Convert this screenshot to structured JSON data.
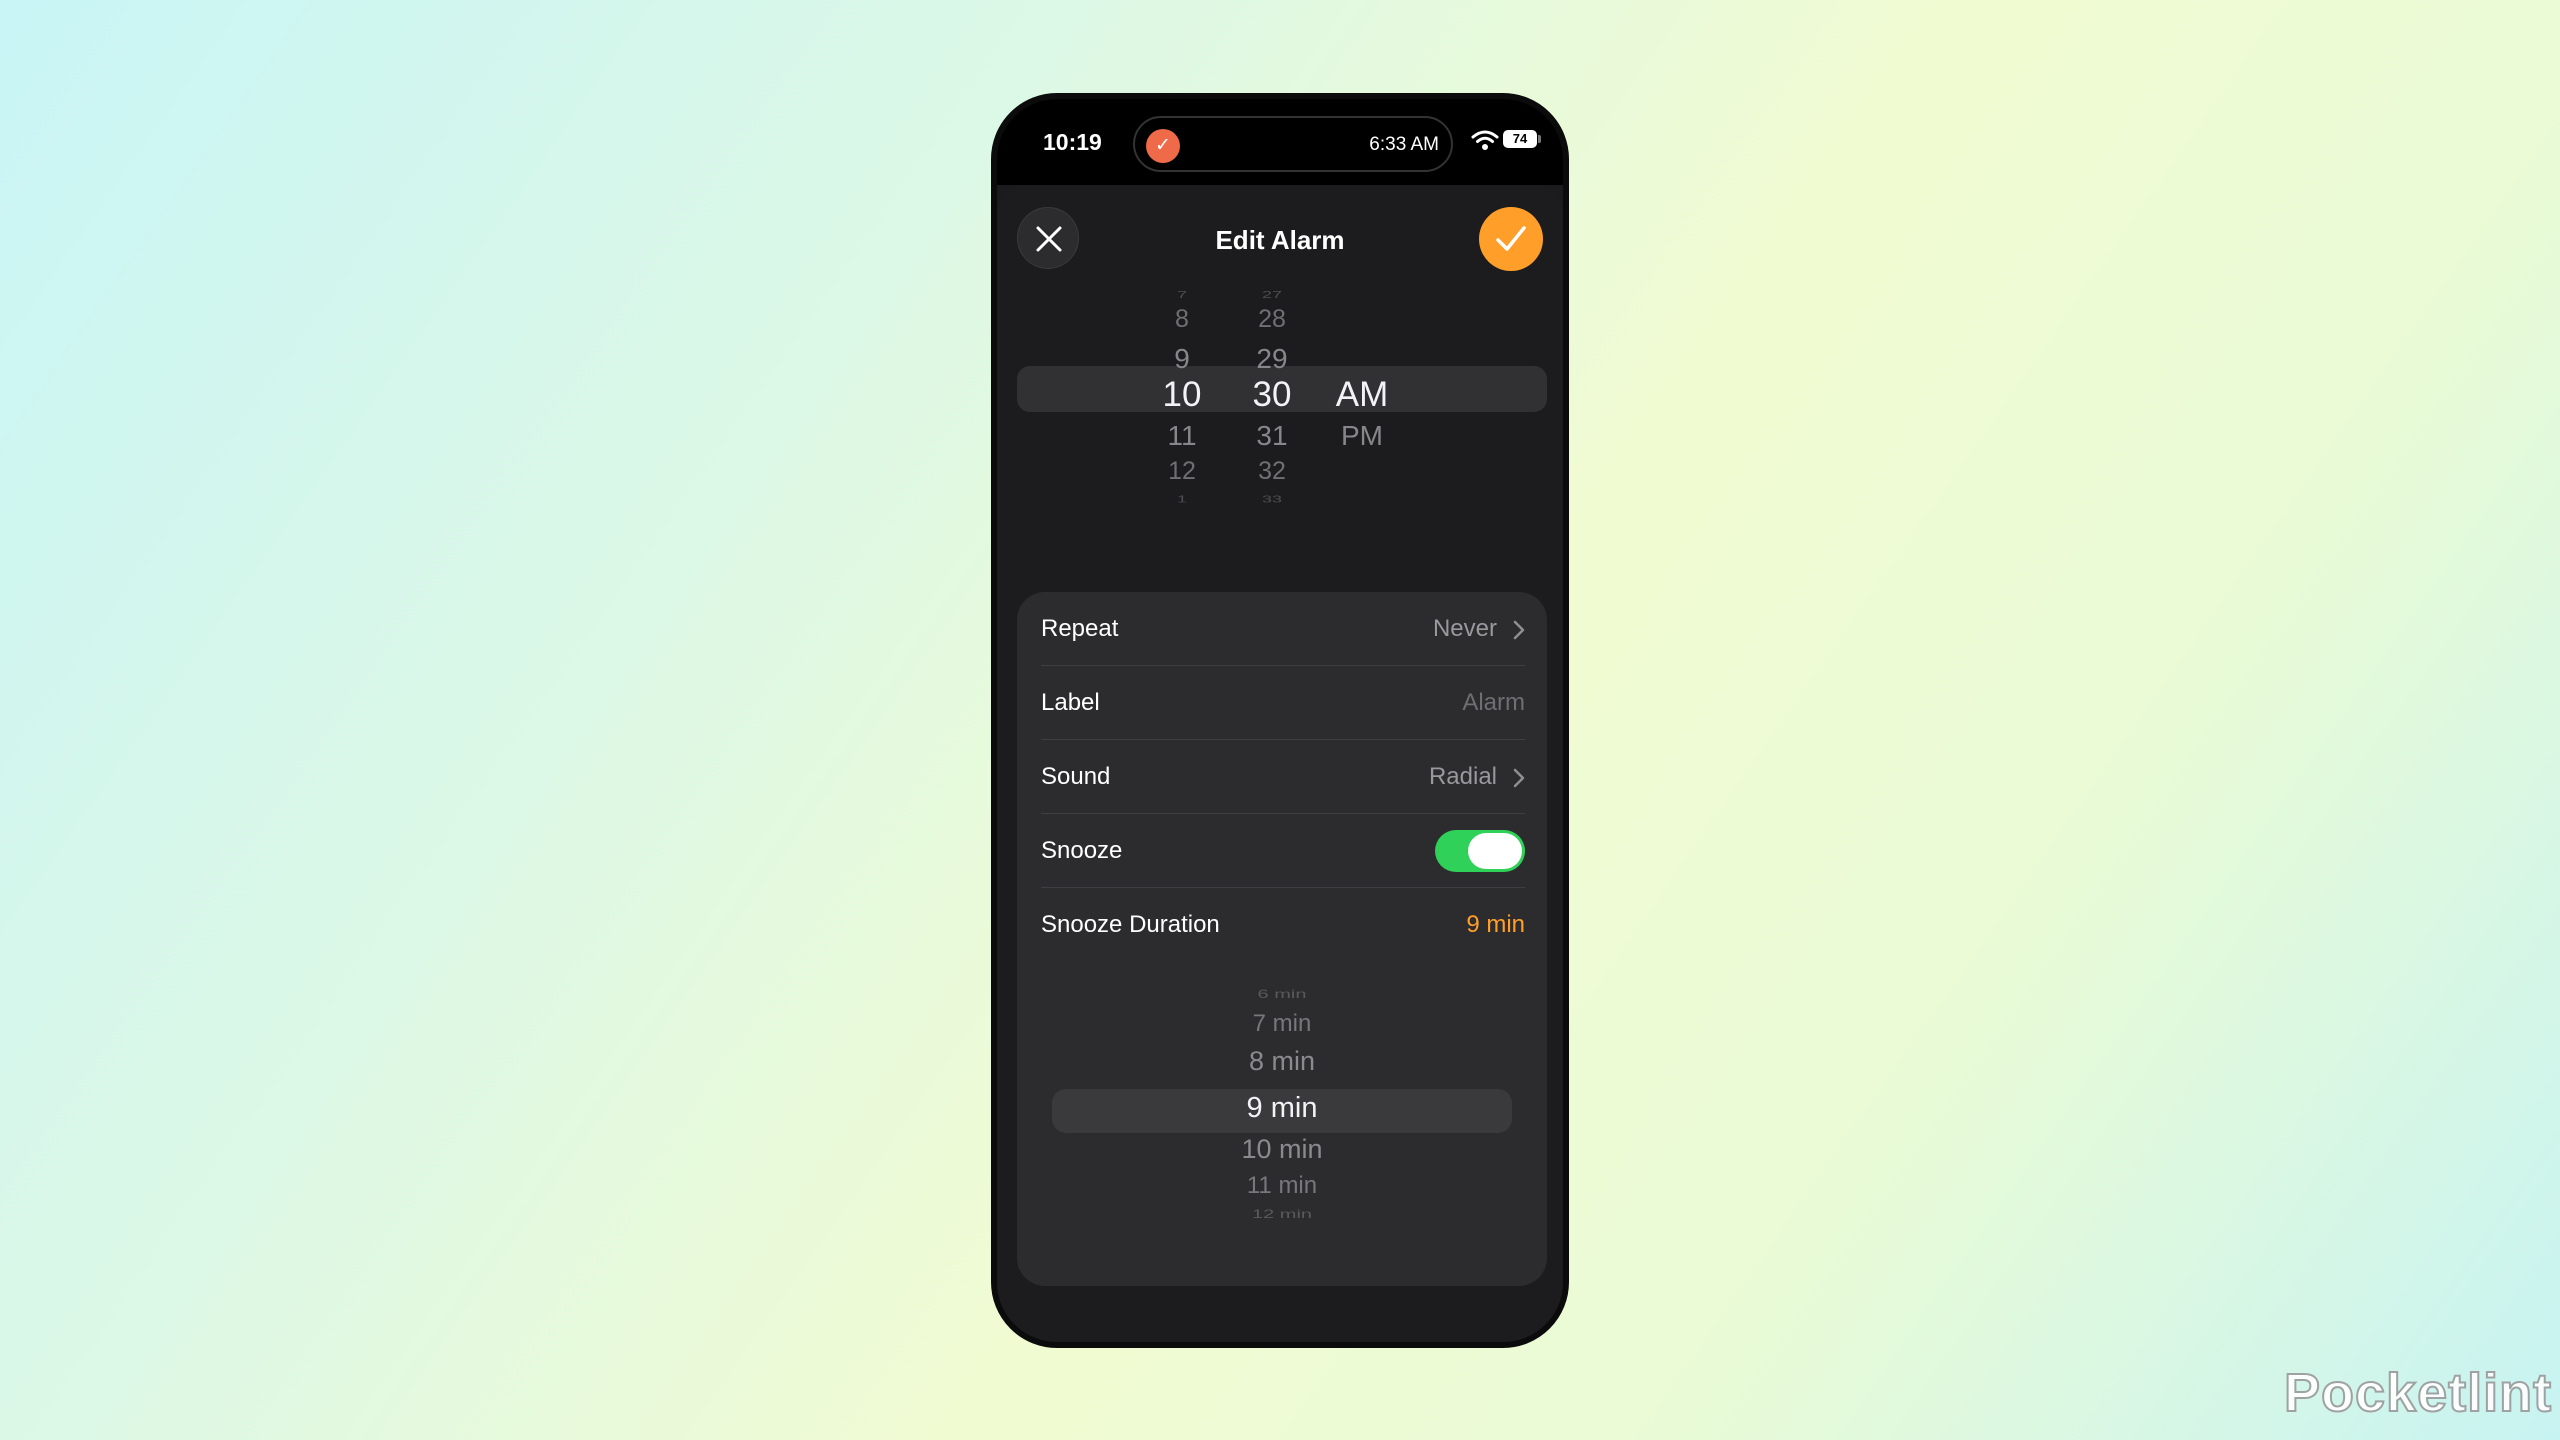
{
  "status_bar": {
    "time": "10:19",
    "island_time": "6:33 AM",
    "island_icon": "timer-icon",
    "battery_level": "74",
    "wifi_icon": "wifi-icon"
  },
  "header": {
    "title": "Edit Alarm",
    "close_icon": "close-icon",
    "confirm_icon": "checkmark-icon",
    "accent_color": "#ff9f2a"
  },
  "time_picker": {
    "hours": [
      "7",
      "8",
      "9",
      "10",
      "11",
      "12",
      "1"
    ],
    "minutes": [
      "27",
      "28",
      "29",
      "30",
      "31",
      "32",
      "33"
    ],
    "periods": [
      "AM",
      "PM"
    ],
    "selected_hour": "10",
    "selected_minute": "30",
    "selected_period": "AM"
  },
  "settings": {
    "repeat": {
      "label": "Repeat",
      "value": "Never"
    },
    "label": {
      "label": "Label",
      "placeholder": "Alarm"
    },
    "sound": {
      "label": "Sound",
      "value": "Radial"
    },
    "snooze": {
      "label": "Snooze",
      "enabled": true,
      "toggle_color": "#30d158"
    },
    "snooze_duration": {
      "label": "Snooze Duration",
      "value": "9 min"
    }
  },
  "snooze_picker": {
    "options": [
      "6 min",
      "7 min",
      "8 min",
      "9 min",
      "10 min",
      "11 min",
      "12 min"
    ],
    "selected": "9 min"
  },
  "watermark": "Pocketlint"
}
